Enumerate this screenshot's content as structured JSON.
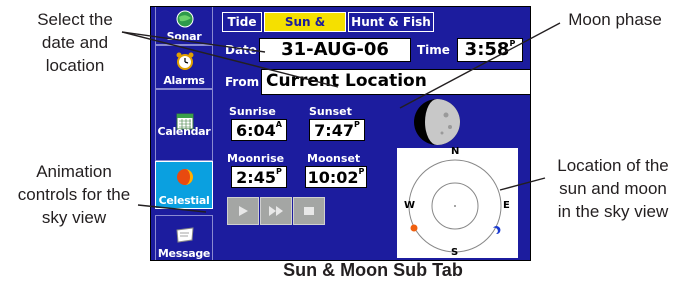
{
  "callouts": {
    "select_date_location": [
      "Select the",
      "date and",
      "location"
    ],
    "animation_controls": [
      "Animation",
      "controls for the",
      "sky view"
    ],
    "moon_phase": "Moon phase",
    "sun_moon_location": [
      "Location of the",
      "sun and moon",
      "in the sky view"
    ]
  },
  "caption": "Sun & Moon Sub Tab",
  "device": {
    "sidebar": {
      "items": [
        {
          "label": "Sonar",
          "icon": "globe-icon"
        },
        {
          "label": "Alarms",
          "icon": "alarm-clock-icon"
        },
        {
          "label": "Calendar",
          "icon": "calendar-icon"
        },
        {
          "label": "Celestial",
          "icon": "celestial-icon",
          "active": true
        },
        {
          "label": "Message",
          "icon": "message-icon"
        }
      ]
    },
    "tabs": [
      {
        "label": "Tide"
      },
      {
        "label": "Sun & Moon",
        "active": true
      },
      {
        "label": "Hunt & Fish"
      }
    ],
    "date_label": "Date",
    "date_value": "31-AUG-06",
    "time_label": "Time",
    "time_value": "3:58",
    "time_ampm": "P",
    "from_label": "From",
    "from_value": "Current Location",
    "sunrise_label": "Sunrise",
    "sunrise_value": "6:04",
    "sunrise_ampm": "A",
    "sunset_label": "Sunset",
    "sunset_value": "7:47",
    "sunset_ampm": "P",
    "moonrise_label": "Moonrise",
    "moonrise_value": "2:45",
    "moonrise_ampm": "P",
    "moonset_label": "Moonset",
    "moonset_value": "10:02",
    "moonset_ampm": "P",
    "sky_view": {
      "north": "N",
      "south": "S",
      "east": "E",
      "west": "W"
    },
    "animation_buttons": [
      "play",
      "fast-forward",
      "stop"
    ],
    "colors": {
      "screen_bg": "#1c1c9e",
      "active_tab": "#f5e000",
      "active_sidebar": "#0aa0e0"
    }
  }
}
